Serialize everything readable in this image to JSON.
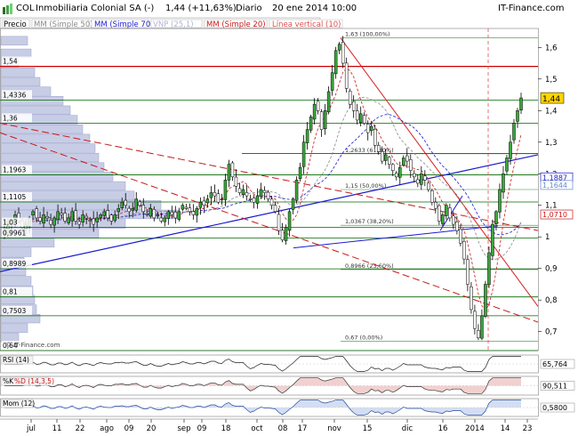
{
  "header": {
    "symbol": "COL",
    "name": "Inmobiliaria Colonial SA (-)",
    "quote": "1,44 (+11,63%)",
    "period": "Diario",
    "date": "20 ene 2014 10:00",
    "brand": "IT-Finance.com"
  },
  "legend": [
    {
      "text": "Precio",
      "color": "#000000"
    },
    {
      "text": "MM (Simple 50)",
      "color": "#888888"
    },
    {
      "text": "MM (Simple 70)",
      "color": "#1a1ad0"
    },
    {
      "text": "VNP (25,1)",
      "color": "#b8bcd8"
    },
    {
      "text": "MM (Simple 20)",
      "color": "#c81818"
    },
    {
      "text": "Línea vertical (10)",
      "color": "#e05050"
    }
  ],
  "chart_data": [
    {
      "type": "candlestick",
      "title": "COL - Inmobiliaria Colonial SA (-)",
      "y_ticks": [
        0.7,
        0.8,
        0.9,
        1,
        1.1,
        1.2,
        1.3,
        1.4,
        1.5,
        1.6
      ],
      "y_tick_labels": [
        "0,7",
        "0,8",
        "0,9",
        "1",
        "1,1",
        "1,2",
        "1,3",
        "1,4",
        "1,5",
        "1,6"
      ],
      "ylim": [
        0.64,
        1.66
      ],
      "x_tick_labels": [
        "jul",
        "11",
        "22",
        "ago",
        "09",
        "20",
        "sep",
        "09",
        "18",
        "oct",
        "08",
        "17",
        "nov",
        "15",
        "dic",
        "16",
        "2014",
        "14",
        "23"
      ],
      "last_price": 1.44,
      "last_price_label": "1,44",
      "right_labels": [
        {
          "value": 1.1887,
          "text": "1,1887",
          "color": "#1a1ad0"
        },
        {
          "value": 1.1644,
          "text": "1,1644",
          "color": "#6688cc"
        },
        {
          "value": 1.071,
          "text": "1,0710",
          "color": "#c81818"
        }
      ],
      "left_levels": [
        {
          "value": 1.54,
          "text": "1,54",
          "color": "#cc0000"
        },
        {
          "value": 1.4336,
          "text": "1,4336",
          "color": "#006600"
        },
        {
          "value": 1.36,
          "text": "1,36",
          "color": "#006600"
        },
        {
          "value": 1.1963,
          "text": "1,1963",
          "color": "#006600"
        },
        {
          "value": 1.1105,
          "text": "1,1105",
          "color": "#006600"
        },
        {
          "value": 1.03,
          "text": "1,03",
          "color": "#006600"
        },
        {
          "value": 0.9961,
          "text": "0,9961",
          "color": "#006600"
        },
        {
          "value": 0.8989,
          "text": "0,8989",
          "color": "#006600"
        },
        {
          "value": 0.81,
          "text": "0,81",
          "color": "#006600"
        },
        {
          "value": 0.7503,
          "text": "0,7503",
          "color": "#006600"
        },
        {
          "value": 0.64,
          "text": "0,64",
          "color": "#006600"
        }
      ],
      "fibonacci": [
        {
          "value": 1.63,
          "text": "1,63 (100,00%)"
        },
        {
          "value": 1.2633,
          "text": "1,2633 (61,80%)"
        },
        {
          "value": 1.15,
          "text": "1,15 (50,00%)"
        },
        {
          "value": 1.0367,
          "text": "1,0367 (38,20%)"
        },
        {
          "value": 0.8966,
          "text": "0,8966 (23,60%)"
        },
        {
          "value": 0.67,
          "text": "0,67 (0,00%)"
        }
      ],
      "series_close": [
        1.02,
        1.05,
        1.04,
        1.07,
        1.05,
        1.03,
        1.04,
        1.06,
        1.08,
        1.06,
        1.05,
        1.07,
        1.06,
        1.04,
        1.06,
        1.08,
        1.07,
        1.05,
        1.06,
        1.08,
        1.05,
        1.04,
        1.07,
        1.06,
        1.05,
        1.04,
        1.06,
        1.07,
        1.08,
        1.06,
        1.05,
        1.07,
        1.09,
        1.11,
        1.1,
        1.08,
        1.09,
        1.12,
        1.1,
        1.08,
        1.07,
        1.09,
        1.06,
        1.07,
        1.05,
        1.06,
        1.08,
        1.07,
        1.06,
        1.08,
        1.1,
        1.09,
        1.08,
        1.07,
        1.09,
        1.11,
        1.1,
        1.12,
        1.14,
        1.13,
        1.11,
        1.12,
        1.18,
        1.23,
        1.19,
        1.16,
        1.14,
        1.15,
        1.13,
        1.12,
        1.11,
        1.13,
        1.15,
        1.14,
        1.12,
        1.1,
        1.08,
        1.02,
        0.99,
        1.03,
        1.08,
        1.12,
        1.18,
        1.22,
        1.3,
        1.34,
        1.38,
        1.42,
        1.4,
        1.34,
        1.4,
        1.46,
        1.52,
        1.59,
        1.61,
        1.55,
        1.47,
        1.42,
        1.4,
        1.37,
        1.39,
        1.36,
        1.33,
        1.35,
        1.29,
        1.27,
        1.24,
        1.26,
        1.23,
        1.21,
        1.19,
        1.22,
        1.25,
        1.24,
        1.21,
        1.19,
        1.17,
        1.2,
        1.18,
        1.15,
        1.11,
        1.09,
        1.05,
        1.07,
        1.1,
        1.06,
        1.04,
        1.02,
        0.98,
        0.93,
        0.85,
        0.77,
        0.71,
        0.68,
        0.75,
        0.85,
        0.95,
        1.04,
        1.08,
        1.15,
        1.2,
        1.25,
        1.3,
        1.36,
        1.4,
        1.44
      ],
      "indicators": [
        {
          "name": "RSI (14)",
          "value": 65.764,
          "value_label": "65,764"
        },
        {
          "name": "%K",
          "name2": "%D (14,3,5)",
          "value": 90.511,
          "value_label": "90,511"
        },
        {
          "name": "Mom (12)",
          "value": 0.58,
          "value_label": "0,5800"
        }
      ]
    }
  ]
}
